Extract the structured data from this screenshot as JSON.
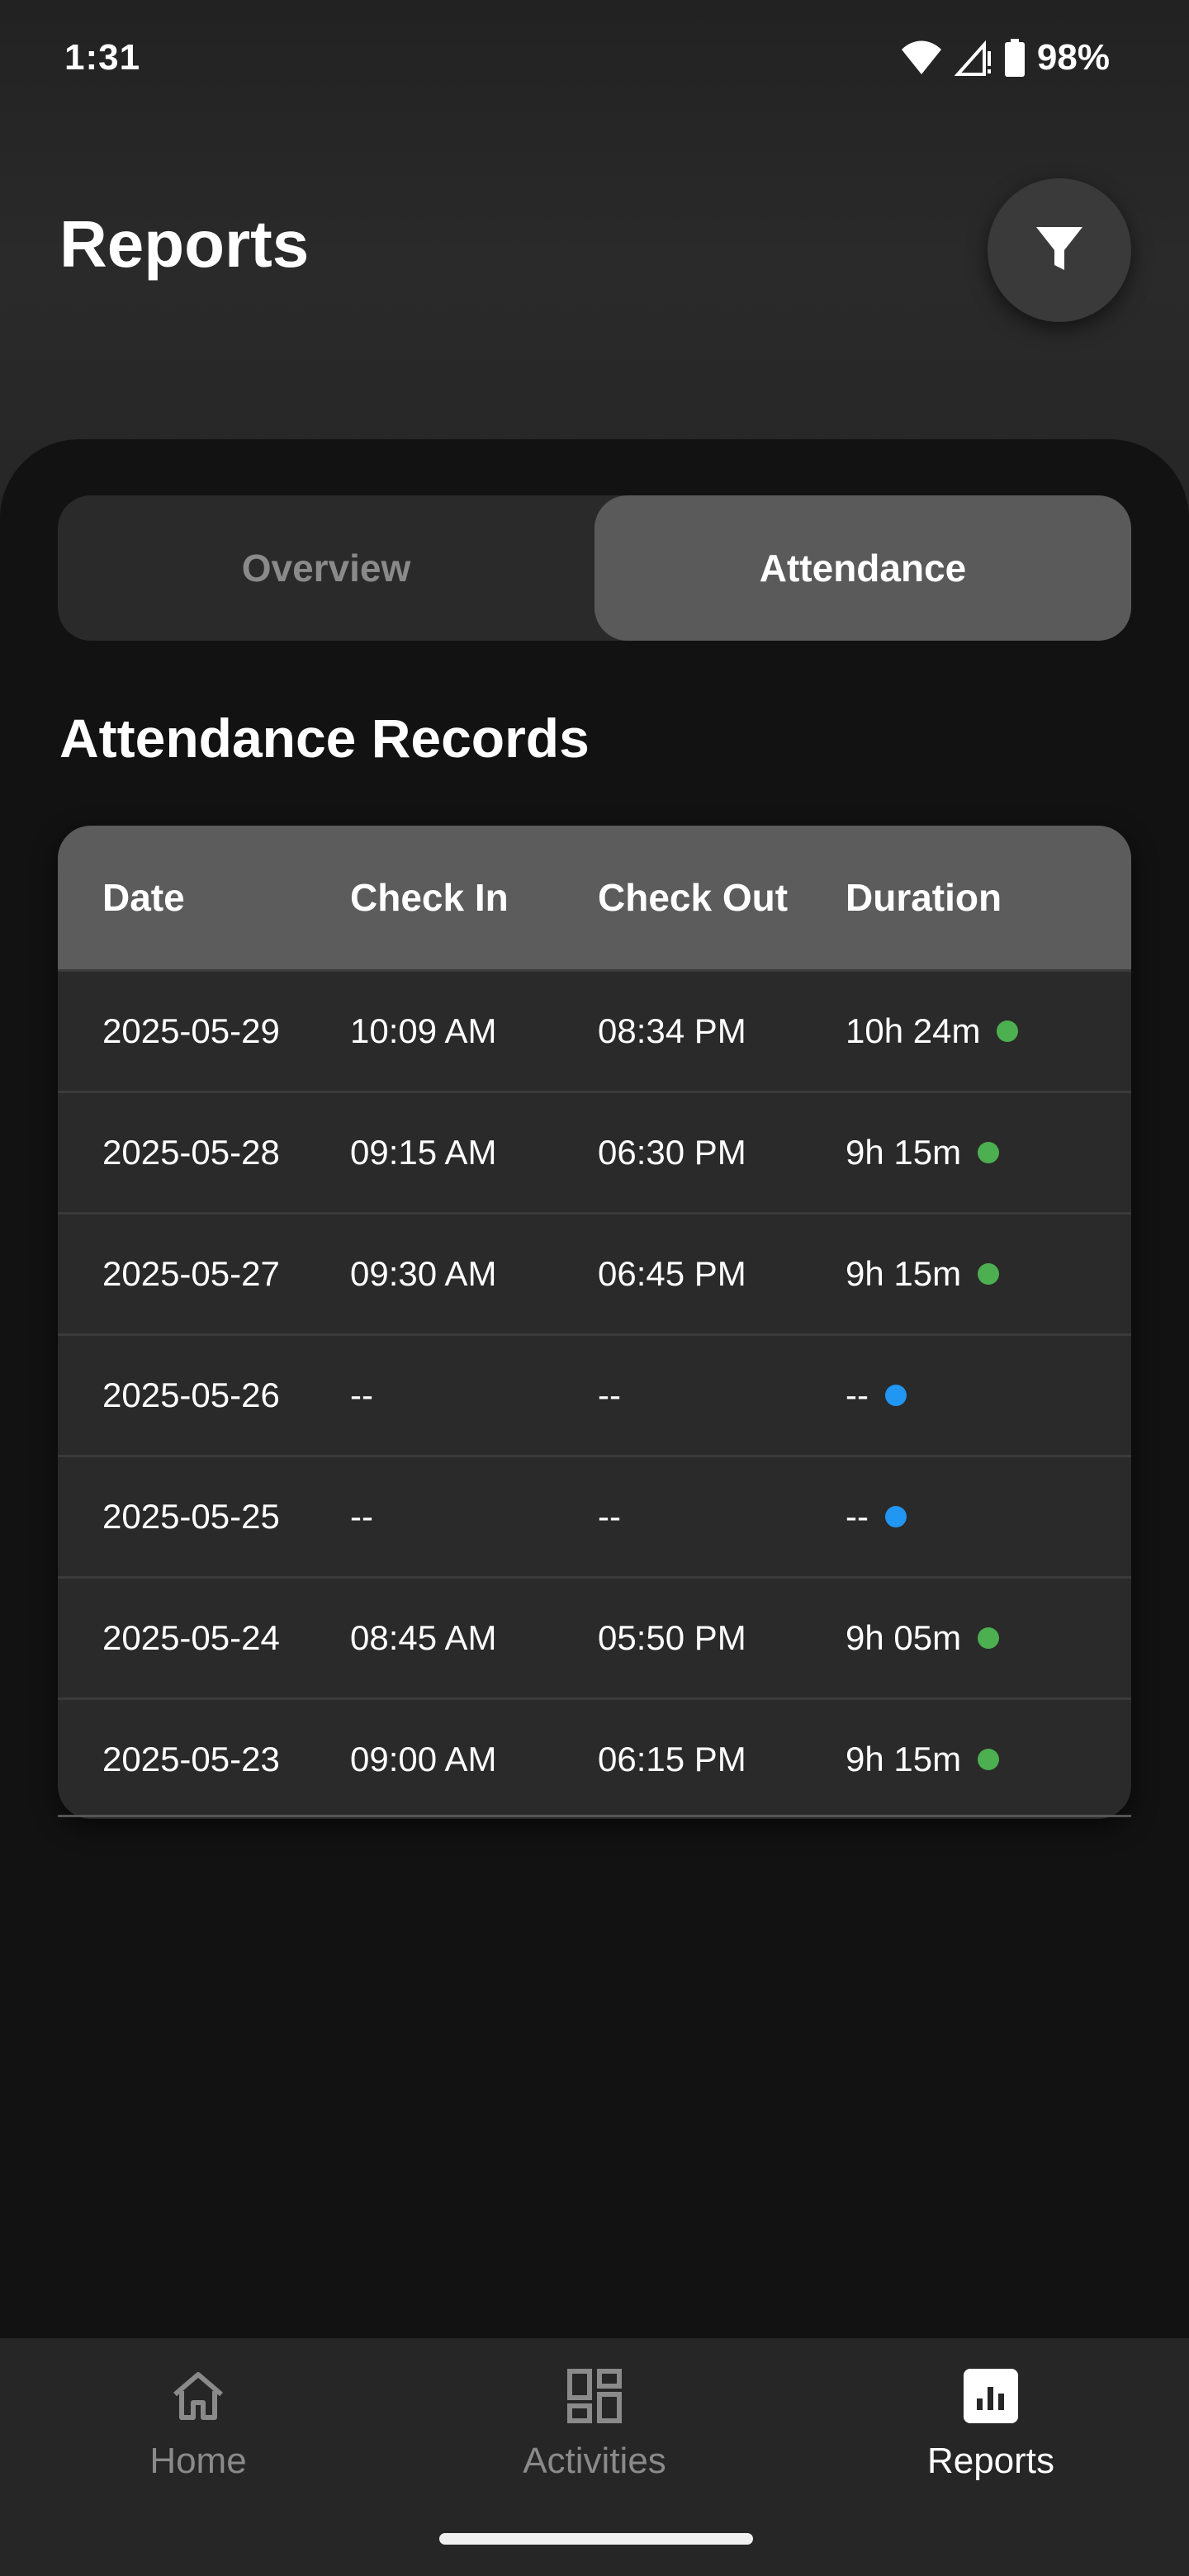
{
  "status_bar": {
    "time": "1:31",
    "battery": "98%",
    "icons": [
      "wifi-icon",
      "signal-icon",
      "battery-icon"
    ]
  },
  "header": {
    "title": "Reports",
    "filter_icon": "filter-icon"
  },
  "tabs": [
    {
      "label": "Overview",
      "active": false
    },
    {
      "label": "Attendance",
      "active": true
    }
  ],
  "section": {
    "title": "Attendance Records"
  },
  "table": {
    "headers": [
      "Date",
      "Check In",
      "Check Out",
      "Duration"
    ],
    "rows": [
      {
        "date": "2025-05-29",
        "check_in": "10:09 AM",
        "check_out": "08:34 PM",
        "duration": "10h 24m",
        "status_color": "#4caf50"
      },
      {
        "date": "2025-05-28",
        "check_in": "09:15 AM",
        "check_out": "06:30 PM",
        "duration": "9h 15m",
        "status_color": "#4caf50"
      },
      {
        "date": "2025-05-27",
        "check_in": "09:30 AM",
        "check_out": "06:45 PM",
        "duration": "9h 15m",
        "status_color": "#4caf50"
      },
      {
        "date": "2025-05-26",
        "check_in": "--",
        "check_out": "--",
        "duration": "--",
        "status_color": "#2196f3"
      },
      {
        "date": "2025-05-25",
        "check_in": "--",
        "check_out": "--",
        "duration": "--",
        "status_color": "#2196f3"
      },
      {
        "date": "2025-05-24",
        "check_in": "08:45 AM",
        "check_out": "05:50 PM",
        "duration": "9h 05m",
        "status_color": "#4caf50"
      },
      {
        "date": "2025-05-23",
        "check_in": "09:00 AM",
        "check_out": "06:15 PM",
        "duration": "9h 15m",
        "status_color": "#4caf50"
      }
    ]
  },
  "bottom_nav": {
    "items": [
      {
        "label": "Home",
        "icon": "home-icon",
        "active": false
      },
      {
        "label": "Activities",
        "icon": "grid-icon",
        "active": false
      },
      {
        "label": "Reports",
        "icon": "bar-chart-icon",
        "active": true
      }
    ]
  },
  "colors": {
    "background": "#111111",
    "header": "#262626",
    "table_header": "#5c5c5c",
    "active_tab": "#5a5a5a",
    "present": "#4caf50",
    "absent": "#2196f3"
  }
}
